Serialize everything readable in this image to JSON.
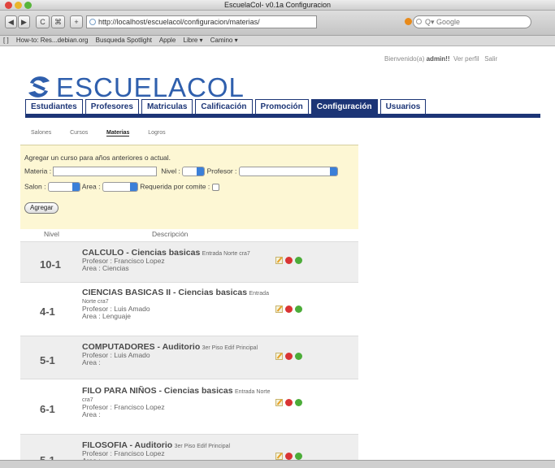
{
  "window": {
    "title": "EscuelaCol- v0.1a Configuracion"
  },
  "toolbar": {
    "back": "◀",
    "forward": "▶",
    "reload": "C",
    "home": "⌘",
    "add": "+",
    "url": "http://localhost/escuelacol/configuracion/materias/",
    "search_placeholder": "Q▾ Google"
  },
  "bookmarks": [
    "[ ]",
    "How-to: Res...debian.org",
    "Busqueda Spotlight",
    "Apple",
    "Libre ▾",
    "Camino ▾"
  ],
  "user": {
    "greeting": "Bienvenido(a)",
    "name": "admin!!",
    "profile": "Ver perfil",
    "logout": "Salir"
  },
  "logo": {
    "text": "ESCUELACOL"
  },
  "nav": {
    "tabs": [
      "Estudiantes",
      "Profesores",
      "Matriculas",
      "Calificación",
      "Promoción",
      "Configuración",
      "Usuarios"
    ],
    "active": "Configuración"
  },
  "subnav": {
    "items": [
      "Salones",
      "Cursos",
      "Materias",
      "Logros"
    ],
    "active": "Materias"
  },
  "form": {
    "intro": "Agregar un curso para años anteriores o actual.",
    "materia_label": "Materia :",
    "nivel_label": "Nivel :",
    "profesor_label": "Profesor :",
    "salon_label": "Salon :",
    "area_label": "Area :",
    "requerida_label": "Requerida por comite :",
    "add_button": "Agregar"
  },
  "list": {
    "header_nivel": "Nivel",
    "header_desc": "Descripción",
    "profesor_prefix": "Profesor : ",
    "area_prefix": "Area : ",
    "rows": [
      {
        "nivel": "10-1",
        "title": "CALCULO - Ciencias basicas",
        "aula": "Entrada Norte cra7",
        "profesor": "Francisco Lopez",
        "area": "Ciencias"
      },
      {
        "nivel": "4-1",
        "title": "CIENCIAS BASICAS II - Ciencias basicas",
        "aula": "Entrada Norte cra7",
        "profesor": "Luis Amado",
        "area": "Lenguaje"
      },
      {
        "nivel": "5-1",
        "title": "COMPUTADORES - Auditorio",
        "aula": "3er Piso Edif Principal",
        "profesor": "Luis Amado",
        "area": ""
      },
      {
        "nivel": "6-1",
        "title": "FILO PARA NIÑOS - Ciencias basicas",
        "aula": "Entrada Norte cra7",
        "profesor": "Francisco Lopez",
        "area": ""
      },
      {
        "nivel": "5-1",
        "title": "FILOSOFIA - Auditorio",
        "aula": "3er Piso Edif Principal",
        "profesor": "Francisco Lopez",
        "area": ""
      }
    ]
  }
}
